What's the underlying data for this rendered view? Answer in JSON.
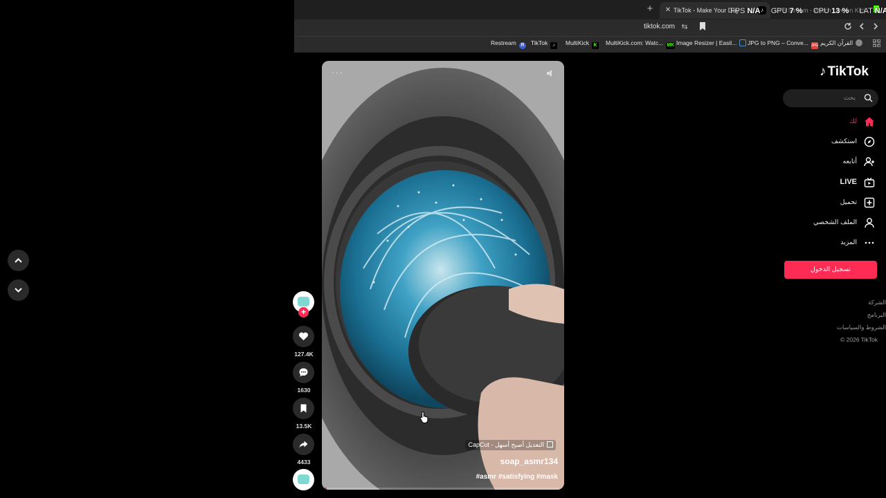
{
  "browser": {
    "active_tab_title": "TikTok - Make Your Day",
    "second_tab_title": "SYB Stream - Watch Live on Kick",
    "new_tab_glyph": "+",
    "close_glyph": "✕",
    "url": "tiktok.com",
    "perf_overlay": {
      "fps_label": "FPS",
      "fps_value": "N/A",
      "gpu_label": "GPU",
      "gpu_value": "7 %",
      "cpu_label": "CPU",
      "cpu_value": "13 %",
      "lat_label": "LAT",
      "lat_value": "N/A"
    },
    "bookmarks": [
      {
        "label": "Restream",
        "badge": "R",
        "color": "#3b5bdb"
      },
      {
        "label": "TikTok",
        "badge": "♪",
        "color": "#000000"
      },
      {
        "label": "MultiKick",
        "badge": "K",
        "color": "#53fc18"
      },
      {
        "label": "MultiKick.com: Watc...",
        "badge": "MK",
        "color": "#53fc18"
      },
      {
        "label": "Image Resizer | Easil...",
        "badge": "",
        "color": "#4a90d9"
      },
      {
        "label": "JPG to PNG – Conve...",
        "badge": "JPG",
        "color": "#e0443e"
      },
      {
        "label": "القرآن الكريم",
        "badge": "",
        "color": "#888888"
      }
    ]
  },
  "video": {
    "capcut_label": "CapCut - التعديل أصبح أسهل",
    "username": "soap_asmr134",
    "hashtags": "#asmr #satisfying #mask",
    "progress": 0.02,
    "menu_glyph": "···"
  },
  "actions": {
    "likes": "127.4K",
    "comments": "1630",
    "saves": "13.5K",
    "shares": "4433",
    "follow_glyph": "+"
  },
  "sidebar": {
    "logo": "TikTok",
    "search_placeholder": "بحث",
    "menu": [
      {
        "label": "لك",
        "icon": "home-icon"
      },
      {
        "label": "استكشف",
        "icon": "compass-icon"
      },
      {
        "label": "أتابعه",
        "icon": "following-icon"
      },
      {
        "label": "LIVE",
        "icon": "live-icon"
      },
      {
        "label": "تحميل",
        "icon": "upload-icon"
      },
      {
        "label": "الملف الشخصي",
        "icon": "profile-icon"
      },
      {
        "label": "المزيد",
        "icon": "more-icon"
      }
    ],
    "login_label": "تسجيل الدخول",
    "footer": [
      "الشركة",
      "البرنامج",
      "الشروط والسياسات",
      "© 2026 TikTok"
    ]
  },
  "colors": {
    "accent": "#fe2c55",
    "kick_green": "#53fc18",
    "water_blue": "#1e7fa8"
  }
}
